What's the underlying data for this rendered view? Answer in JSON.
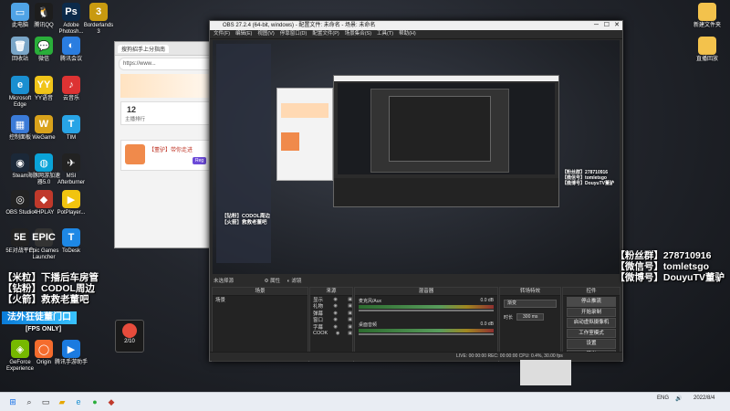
{
  "desktop": {
    "left_icons": [
      {
        "name": "this-pc-icon",
        "label": "此电脑",
        "color": "#4fa3e6",
        "glyph": "▭"
      },
      {
        "name": "qq-icon",
        "label": "腾讯QQ",
        "color": "#1d1d1d",
        "glyph": "🐧"
      },
      {
        "name": "photoshop-icon",
        "label": "Adobe\nPhotosh...",
        "color": "#0b2a4a",
        "glyph": "Ps"
      },
      {
        "name": "borderlands-icon",
        "label": "Borderlands\n3",
        "color": "#c89a10",
        "glyph": "3"
      },
      {
        "name": "recycle-bin-icon",
        "label": "回收站",
        "color": "#7aa6c8",
        "glyph": "🗑"
      },
      {
        "name": "wechat-icon",
        "label": "微信",
        "color": "#2aae3a",
        "glyph": "💬"
      },
      {
        "name": "tencent-meeting-icon",
        "label": "腾讯会议",
        "color": "#2a7de0",
        "glyph": "◐"
      },
      {
        "name": "edge-icon",
        "label": "Microsoft\nEdge",
        "color": "#1a8fd1",
        "glyph": "e"
      },
      {
        "name": "yy-icon",
        "label": "YY语音",
        "color": "#f0c419",
        "glyph": "YY"
      },
      {
        "name": "cloud-music-icon",
        "label": "云音乐",
        "color": "#d33",
        "glyph": "♪"
      },
      {
        "name": "control-panel-icon",
        "label": "控制面板",
        "color": "#3b7bd8",
        "glyph": "▦"
      },
      {
        "name": "wegame-icon",
        "label": "WeGame",
        "color": "#d9a21b",
        "glyph": "W"
      },
      {
        "name": "tim-icon",
        "label": "TIM",
        "color": "#28a4e6",
        "glyph": "T"
      },
      {
        "name": "steam-icon",
        "label": "Steam",
        "color": "#1b2838",
        "glyph": "◉"
      },
      {
        "name": "accelerator-icon",
        "label": "海豚网游加速\n器5.0",
        "color": "#0aa3d8",
        "glyph": "◍"
      },
      {
        "name": "afterburner-icon",
        "label": "MSI\nAfterburner",
        "color": "#222",
        "glyph": "✈"
      },
      {
        "name": "obs-icon",
        "label": "OBS Studio",
        "color": "#222",
        "glyph": "◎"
      },
      {
        "name": "4hplay-icon",
        "label": "4HPLAY",
        "color": "#c0392b",
        "glyph": "◆"
      },
      {
        "name": "potplayer-icon",
        "label": "PotPlayer...",
        "color": "#f1c40f",
        "glyph": "▶"
      },
      {
        "name": "5e-icon",
        "label": "5E对战平台",
        "color": "#222",
        "glyph": "5E"
      },
      {
        "name": "epic-icon",
        "label": "Epic Games\nLauncher",
        "color": "#333",
        "glyph": "EPIC"
      },
      {
        "name": "todesk-icon",
        "label": "ToDesk",
        "color": "#1e88e5",
        "glyph": "T"
      },
      {
        "name": "geforce-icon",
        "label": "GeForce\nExperience",
        "color": "#76b900",
        "glyph": "◈"
      },
      {
        "name": "origin-icon",
        "label": "Origin",
        "color": "#f56c2d",
        "glyph": "◯"
      },
      {
        "name": "tencent-video-icon",
        "label": "腾讯手游助手",
        "color": "#1b7be0",
        "glyph": "▶"
      }
    ],
    "right_icons": [
      {
        "name": "folder-icon",
        "label": "新建文件夹",
        "color": "#f3c24c",
        "glyph": "📁"
      },
      {
        "name": "folder-icon",
        "label": "直播回放",
        "color": "#f3c24c",
        "glyph": "📁"
      }
    ]
  },
  "browser": {
    "tab_title": "搜狗招手上分指南",
    "address": "https://www...",
    "home_label": "首页",
    "stat_number": "12",
    "stat_label": "主播排行",
    "card_text": "【董驴】带你走进",
    "button_label": "Reg"
  },
  "obs": {
    "title": "OBS 27.2.4 (64-bit, windows) - 配置文件: 未命名 - 场景: 未命名",
    "menu": [
      "文件(F)",
      "编辑(E)",
      "视图(V)",
      "停靠窗口(D)",
      "配置文件(P)",
      "场景集合(S)",
      "工具(T)",
      "帮助(H)"
    ],
    "studio_mode": "未选择源",
    "tab_props": "属性",
    "tab_filters": "滤镜",
    "docks": {
      "scenes": {
        "title": "场景",
        "items": [
          "场景"
        ]
      },
      "sources": {
        "title": "来源",
        "items": [
          "显示",
          "礼物",
          "弹幕",
          "窗口",
          "字幕",
          "COOK"
        ]
      },
      "mixer": {
        "title": "混音器",
        "channels": [
          {
            "name": "麦克风/Aux",
            "level": "0.0 dB"
          },
          {
            "name": "桌面音频",
            "level": "0.0 dB"
          }
        ]
      },
      "transitions": {
        "title": "转场特效",
        "type": "渐变",
        "duration_label": "时长",
        "duration": "300 ms"
      },
      "controls": {
        "title": "控件",
        "buttons": [
          "停止推流",
          "开始录制",
          "启动虚拟摄像机",
          "工作室模式",
          "设置",
          "退出"
        ]
      }
    },
    "status": "LIVE: 00:00:00   REC: 00:00:00   CPU: 0.4%, 30.00 fps"
  },
  "overlays": {
    "fans_lines": [
      "【粉丝群】278710916",
      "【微信号】tomletsgo",
      "【微博号】DouyuTV董驴"
    ],
    "left_lines": [
      "【米粒】下播后车房管",
      "【钻粉】CODOL周边",
      "【火箭】救救老董吧"
    ],
    "banner": "法外狂徒董门口",
    "fps": "[FPS ONLY]",
    "counter": "2/10"
  },
  "taskbar": {
    "lang": "ENG",
    "time": "2022/8/4"
  }
}
